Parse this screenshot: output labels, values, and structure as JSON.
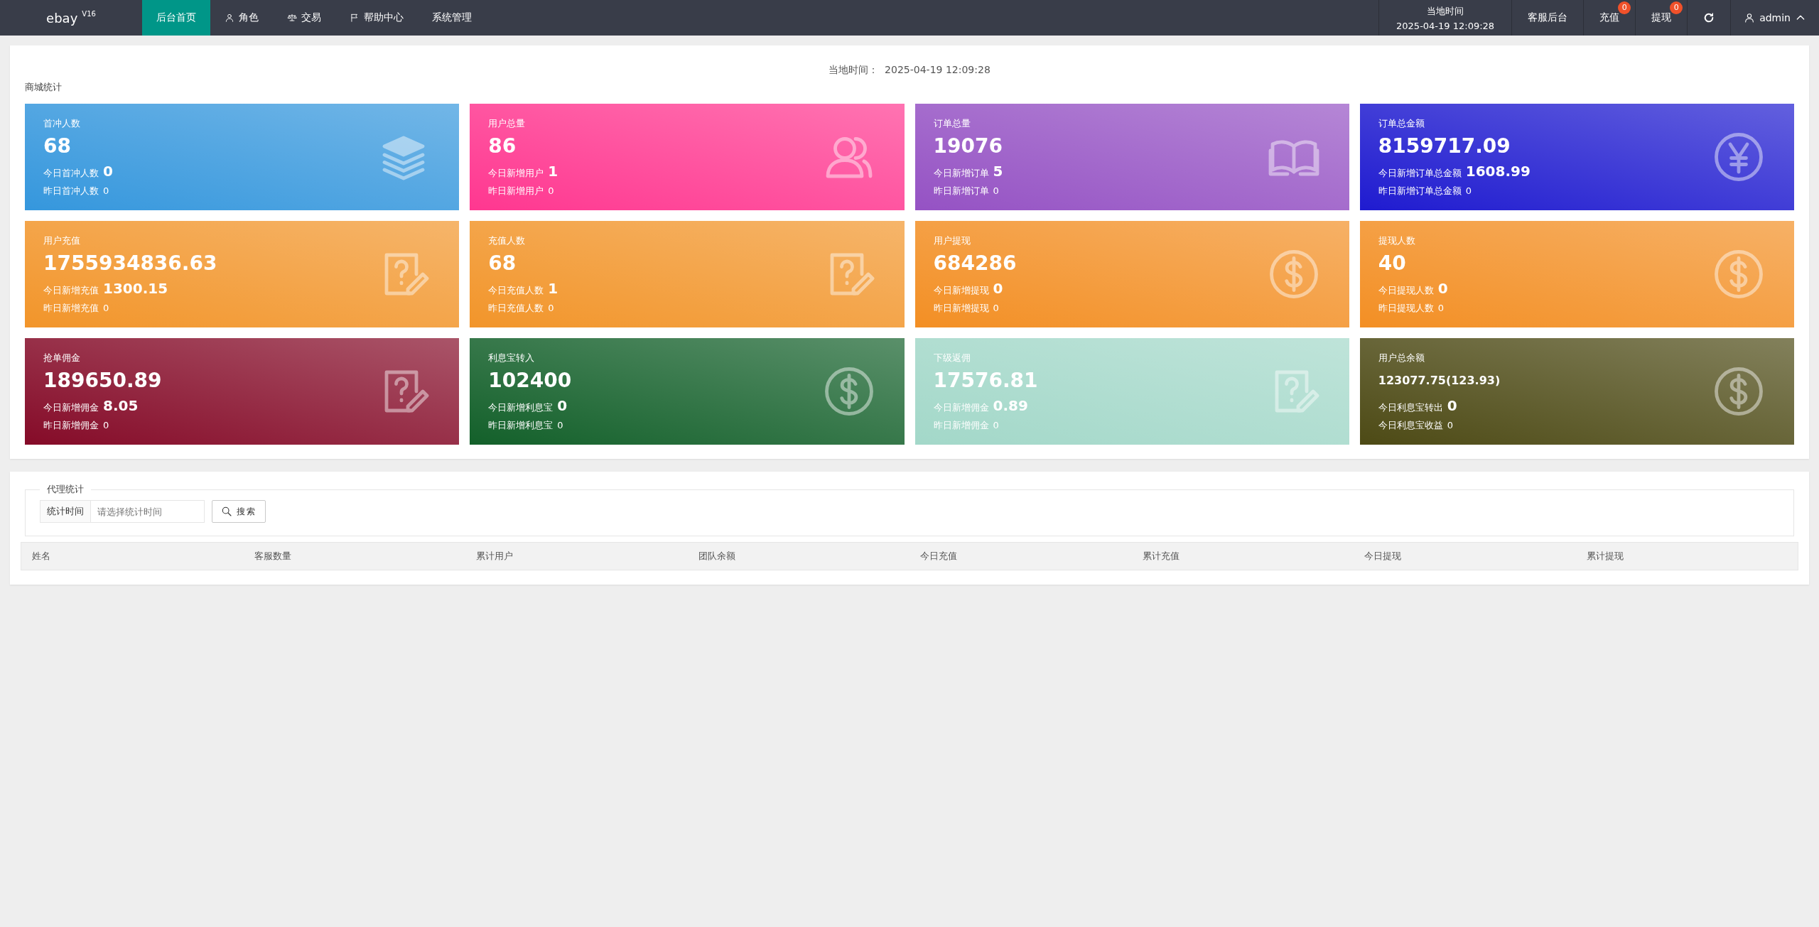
{
  "topbar": {
    "logo": "ebay",
    "version": "V16",
    "nav": [
      {
        "label": "后台首页",
        "kind": "plain",
        "selected": true
      },
      {
        "label": "角色",
        "kind": "user",
        "selected": false
      },
      {
        "label": "交易",
        "kind": "scale",
        "selected": false
      },
      {
        "label": "帮助中心",
        "kind": "flag",
        "selected": false
      },
      {
        "label": "系统管理",
        "kind": "plain",
        "selected": false
      }
    ],
    "clock": {
      "label": "当地时间",
      "time": "2025-04-19 12:09:28"
    },
    "links": [
      {
        "label": "客服后台"
      },
      {
        "label": "充值",
        "badge": "0"
      },
      {
        "label": "提现",
        "badge": "0"
      }
    ],
    "user": "admin"
  },
  "overview": {
    "local_time_label": "当地时间：",
    "local_time": "2025-04-19 12:09:28",
    "title": "商城统计",
    "cards": [
      {
        "title": "首冲人数",
        "value": "68",
        "today_label": "今日首冲人数",
        "today": "0",
        "yesterday_label": "昨日首冲人数",
        "yesterday": "0",
        "kind": "layers",
        "compact": false,
        "color": "#3597dd"
      },
      {
        "title": "用户总量",
        "value": "86",
        "today_label": "今日新增用户",
        "today": "1",
        "yesterday_label": "昨日新增用户",
        "yesterday": "0",
        "kind": "users",
        "compact": false,
        "color": "#ff3790"
      },
      {
        "title": "订单总量",
        "value": "19076",
        "today_label": "今日新增订单",
        "today": "5",
        "yesterday_label": "昨日新增订单",
        "yesterday": "0",
        "kind": "book",
        "compact": false,
        "color": "#9552c4"
      },
      {
        "title": "订单总金额",
        "value": "8159717.09",
        "today_label": "今日新增订单总金额",
        "today": "1608.99",
        "yesterday_label": "昨日新增订单总金额",
        "yesterday": "0",
        "kind": "yen",
        "compact": false,
        "color": "#1f1bd0"
      },
      {
        "title": "用户充值",
        "value": "1755934836.63",
        "today_label": "今日新增充值",
        "today": "1300.15",
        "yesterday_label": "昨日新增充值",
        "yesterday": "0",
        "kind": "note",
        "compact": false,
        "color": "#f2952a"
      },
      {
        "title": "充值人数",
        "value": "68",
        "today_label": "今日充值人数",
        "today": "1",
        "yesterday_label": "昨日充值人数",
        "yesterday": "0",
        "kind": "note",
        "compact": false,
        "color": "#f2952a"
      },
      {
        "title": "用户提现",
        "value": "684286",
        "today_label": "今日新增提现",
        "today": "0",
        "yesterday_label": "昨日新增提现",
        "yesterday": "0",
        "kind": "dollar",
        "compact": false,
        "color": "#f38f24"
      },
      {
        "title": "提现人数",
        "value": "40",
        "today_label": "今日提现人数",
        "today": "0",
        "yesterday_label": "昨日提现人数",
        "yesterday": "0",
        "kind": "dollar",
        "compact": false,
        "color": "#f38f24"
      },
      {
        "title": "抢单佣金",
        "value": "189650.89",
        "today_label": "今日新增佣金",
        "today": "8.05",
        "yesterday_label": "昨日新增佣金",
        "yesterday": "0",
        "kind": "note",
        "compact": false,
        "color": "#850b28"
      },
      {
        "title": "利息宝转入",
        "value": "102400",
        "today_label": "今日新增利息宝",
        "today": "0",
        "yesterday_label": "昨日新增利息宝",
        "yesterday": "0",
        "kind": "dollar",
        "compact": false,
        "color": "#13602a"
      },
      {
        "title": "下级返佣",
        "value": "17576.81",
        "today_label": "今日新增佣金",
        "today": "0.89",
        "yesterday_label": "昨日新增佣金",
        "yesterday": "0",
        "kind": "note",
        "compact": false,
        "color": "#a3d8c9"
      },
      {
        "title": "用户总余额",
        "value": "123077.75(123.93)",
        "today_label": "今日利息宝转出",
        "today": "0",
        "yesterday_label": "今日利息宝收益",
        "yesterday": "0",
        "kind": "dollar",
        "compact": true,
        "color": "#4d4a15"
      }
    ]
  },
  "agents": {
    "legend": "代理统计",
    "filter_label": "统计时间",
    "filter": {
      "placeholder": "请选择统计时间"
    },
    "search_button": "搜索",
    "table": {
      "columns": [
        "姓名",
        "客服数量",
        "累计用户",
        "团队余额",
        "今日充值",
        "累计充值",
        "今日提现",
        "累计提现"
      ]
    }
  }
}
